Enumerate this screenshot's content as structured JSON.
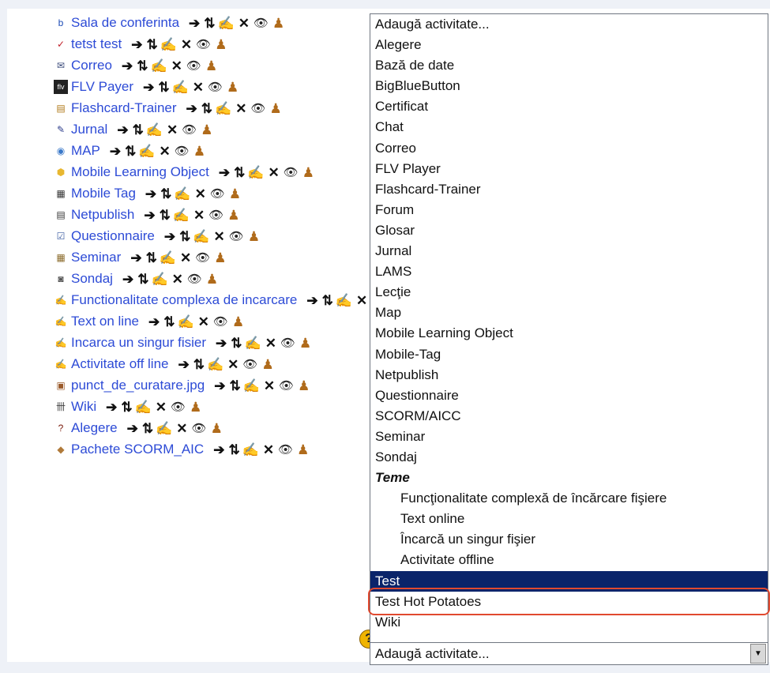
{
  "activities": [
    {
      "label": "Sala de conferinta",
      "icon": "bigbluebutton-icon",
      "glyph": "b",
      "color": "#1e4db6"
    },
    {
      "label": "tetst test",
      "icon": "quiz-icon",
      "glyph": "✓",
      "color": "#c0202a"
    },
    {
      "label": "Correo",
      "icon": "mail-icon",
      "glyph": "✉",
      "color": "#3a4a7a"
    },
    {
      "label": "FLV Payer",
      "icon": "flv-icon",
      "glyph": "flv",
      "color": "#222222"
    },
    {
      "label": "Flashcard-Trainer",
      "icon": "flashcard-icon",
      "glyph": "▤",
      "color": "#b07a1a"
    },
    {
      "label": "Jurnal",
      "icon": "journal-icon",
      "glyph": "✎",
      "color": "#2a3a8a"
    },
    {
      "label": "MAP",
      "icon": "globe-icon",
      "glyph": "◉",
      "color": "#3b79c9"
    },
    {
      "label": "Mobile Learning Object",
      "icon": "cube-icon",
      "glyph": "⬢",
      "color": "#e8b730"
    },
    {
      "label": "Mobile Tag",
      "icon": "qr-code-icon",
      "glyph": "▦",
      "color": "#333333"
    },
    {
      "label": "Netpublish",
      "icon": "newspaper-icon",
      "glyph": "▤",
      "color": "#333333"
    },
    {
      "label": "Questionnaire",
      "icon": "questionnaire-icon",
      "glyph": "☑",
      "color": "#3a5aa0"
    },
    {
      "label": "Seminar",
      "icon": "seminar-icon",
      "glyph": "▦",
      "color": "#8a6a2a"
    },
    {
      "label": "Sondaj",
      "icon": "survey-icon",
      "glyph": "◙",
      "color": "#555555"
    },
    {
      "label": "Functionalitate complexa de incarcare",
      "icon": "upload-icon",
      "glyph": "✍",
      "color": "#6a5a3a"
    },
    {
      "label": "Text on line",
      "icon": "upload-icon",
      "glyph": "✍",
      "color": "#6a5a3a"
    },
    {
      "label": "Incarca un singur fisier",
      "icon": "upload-icon",
      "glyph": "✍",
      "color": "#6a5a3a"
    },
    {
      "label": "Activitate off line",
      "icon": "upload-icon",
      "glyph": "✍",
      "color": "#6a5a3a"
    },
    {
      "label": "punct_de_curatare.jpg",
      "icon": "image-file-icon",
      "glyph": "▣",
      "color": "#9a5a2a"
    },
    {
      "label": "Wiki",
      "icon": "wiki-icon",
      "glyph": "卌",
      "color": "#444444"
    },
    {
      "label": "Alegere",
      "icon": "question-mark-icon",
      "glyph": "?",
      "color": "#7a1a0a"
    },
    {
      "label": "Pachete SCORM_AIC",
      "icon": "package-icon",
      "glyph": "◆",
      "color": "#b07a3a"
    }
  ],
  "controls": {
    "move": "➔",
    "updown": "⇅",
    "edit": "✍",
    "delete": "✕",
    "hide": "👁",
    "roles": "♟"
  },
  "dropdown": {
    "options": [
      "Adaugă activitate...",
      "Alegere",
      "Bază de date",
      "BigBlueButton",
      "Certificat",
      "Chat",
      "Correo",
      "FLV Player",
      "Flashcard-Trainer",
      "Forum",
      "Glosar",
      "Jurnal",
      "LAMS",
      "Lecţie",
      "Map",
      "Mobile Learning Object",
      "Mobile-Tag",
      "Netpublish",
      "Questionnaire",
      "SCORM/AICC",
      "Seminar",
      "Sondaj"
    ],
    "group_label": "Teme",
    "group_options": [
      "Funcţionalitate complexă de încărcare fişiere",
      "Text online",
      "Încarcă un singur fişier",
      "Activitate offline"
    ],
    "after_options": [
      "Test",
      "Test Hot Potatoes",
      "Wiki"
    ],
    "selected": "Test",
    "select_value": "Adaugă activitate...",
    "selection_highlight_color": "#0a246a",
    "annotation_color": "#e1492f"
  },
  "help_icon_glyph": "?"
}
